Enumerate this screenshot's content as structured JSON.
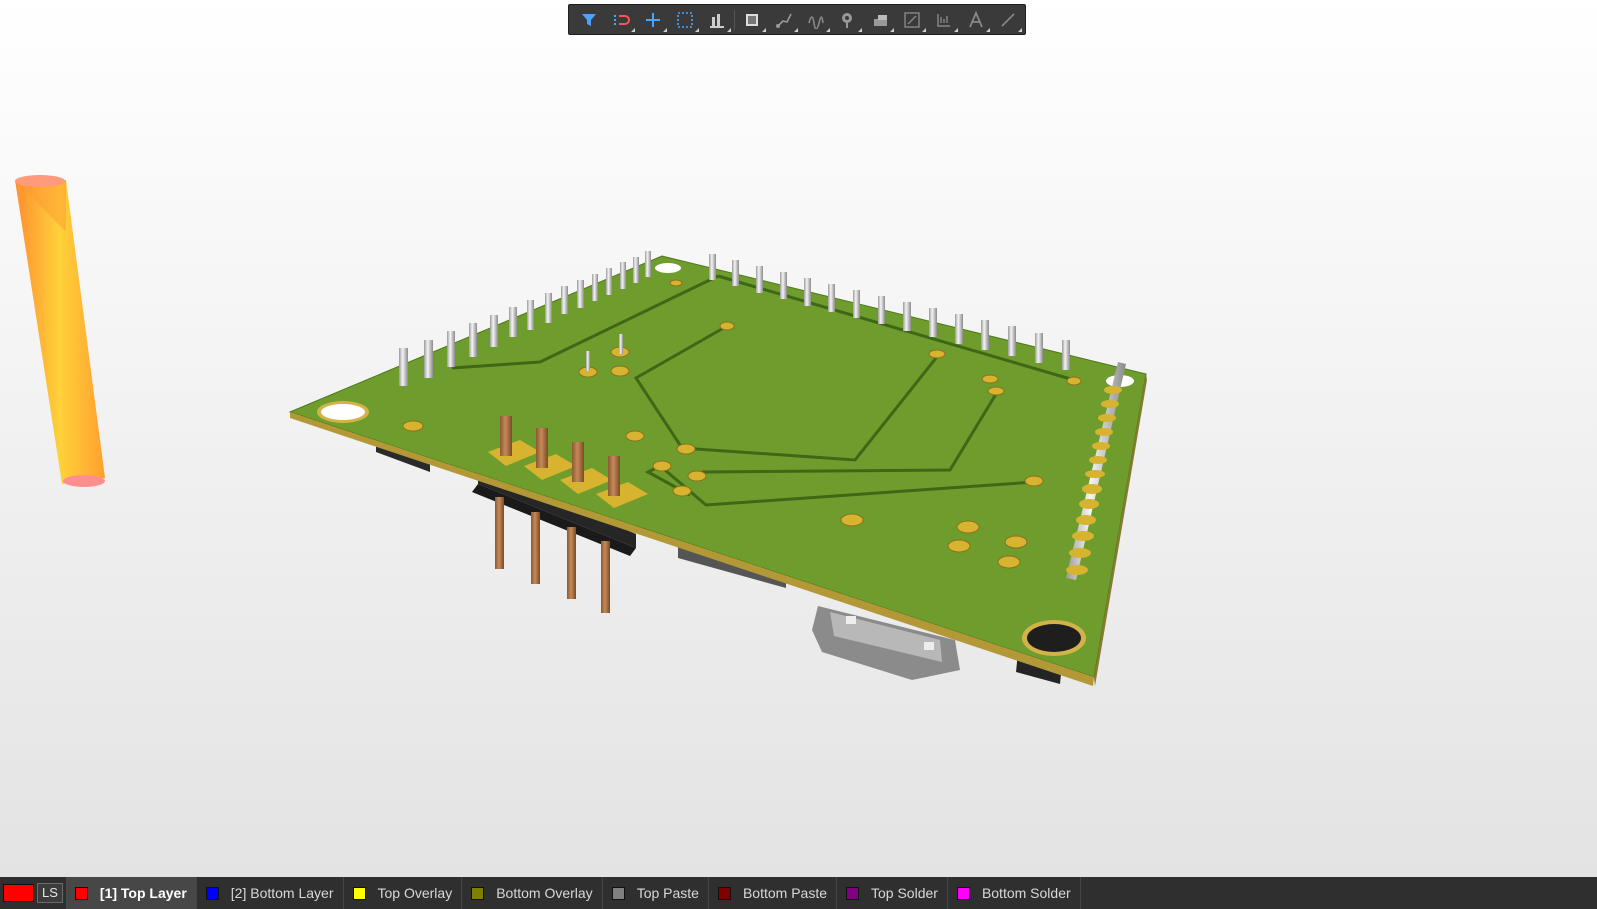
{
  "app": {
    "view": "PCB 3D View"
  },
  "toolbar": {
    "buttons": [
      {
        "name": "filter-icon",
        "tooltip": "Selection Filter"
      },
      {
        "name": "move-icon",
        "tooltip": "Move"
      },
      {
        "name": "crosshair-icon",
        "tooltip": "Add"
      },
      {
        "name": "select-rect-icon",
        "tooltip": "Select"
      },
      {
        "name": "align-icon",
        "tooltip": "Align"
      },
      {
        "name": "component-icon",
        "tooltip": "Component"
      },
      {
        "name": "route-icon",
        "tooltip": "Route"
      },
      {
        "name": "tune-icon",
        "tooltip": "Length Tuning"
      },
      {
        "name": "via-icon",
        "tooltip": "Place Via"
      },
      {
        "name": "polygon-icon",
        "tooltip": "Polygon"
      },
      {
        "name": "dimension-icon",
        "tooltip": "Dimension"
      },
      {
        "name": "string-icon",
        "tooltip": "String"
      },
      {
        "name": "text-icon",
        "tooltip": "Text"
      },
      {
        "name": "line-icon",
        "tooltip": "Line"
      }
    ]
  },
  "colors": {
    "board": "#6a9a2a",
    "board_edge": "#b59a3a",
    "copper_pad": "#d7b330",
    "pin_silver": "#dcdcdc",
    "pin_copper": "#b07a4a",
    "current_layer": "#ff0000"
  },
  "layer_bar": {
    "current_layer_color": "#ff0000",
    "ls_label": "LS",
    "tabs": [
      {
        "label": "[1] Top Layer",
        "color": "#ff0000",
        "active": true
      },
      {
        "label": "[2] Bottom Layer",
        "color": "#0000ff",
        "active": false
      },
      {
        "label": "Top Overlay",
        "color": "#ffff00",
        "active": false
      },
      {
        "label": "Bottom Overlay",
        "color": "#808000",
        "active": false
      },
      {
        "label": "Top Paste",
        "color": "#808080",
        "active": false
      },
      {
        "label": "Bottom Paste",
        "color": "#800000",
        "active": false
      },
      {
        "label": "Top Solder",
        "color": "#800080",
        "active": false
      },
      {
        "label": "Bottom Solder",
        "color": "#ff00ff",
        "active": false
      }
    ]
  }
}
